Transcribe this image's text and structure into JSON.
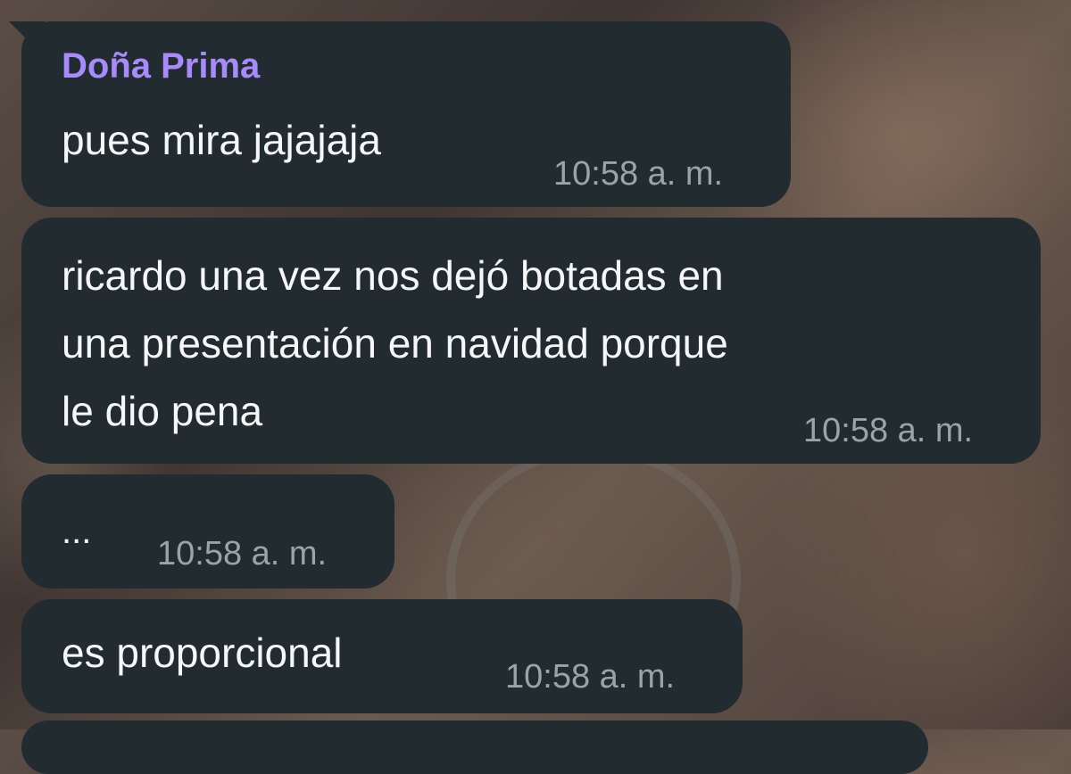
{
  "chat": {
    "sender": "Doña Prima",
    "messages": [
      {
        "lines": [
          "pues mira jajajaja"
        ],
        "time": "10:58 a. m."
      },
      {
        "lines": [
          "ricardo una vez nos dejó botadas en",
          "una presentación en navidad porque",
          "le dio pena"
        ],
        "time": "10:58 a. m."
      },
      {
        "lines": [
          "..."
        ],
        "time": "10:58 a. m."
      },
      {
        "lines": [
          "es proporcional"
        ],
        "time": "10:58 a. m."
      }
    ]
  },
  "colors": {
    "bubble": "#212b30",
    "sender_name": "#a78bfa",
    "timestamp": "#9aa3a8",
    "text": "#f4f6f7"
  }
}
